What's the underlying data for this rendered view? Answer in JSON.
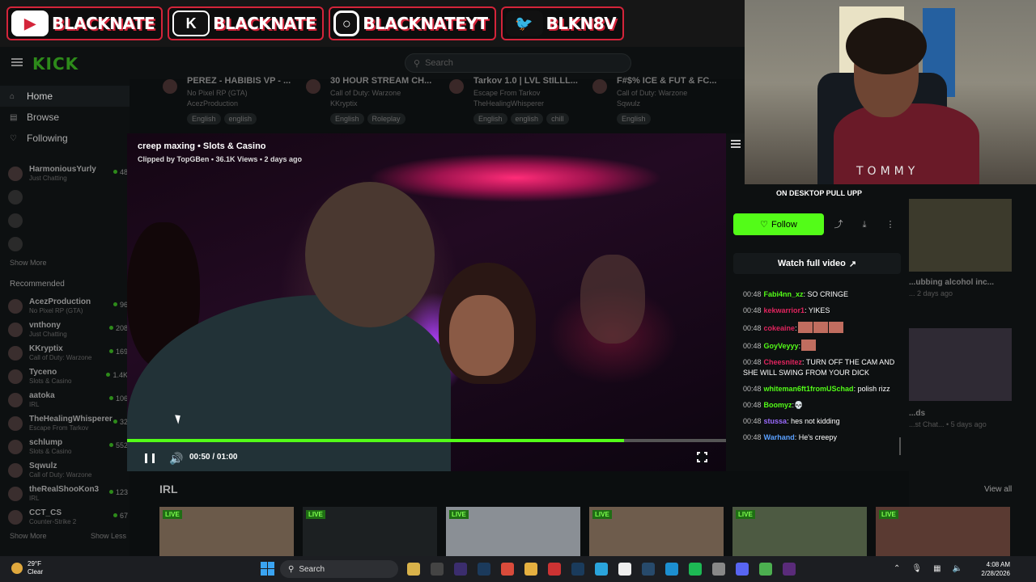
{
  "social": [
    {
      "icon": "youtube-icon",
      "label": "BLACKNATE"
    },
    {
      "icon": "kick-icon",
      "label": "BLACKNATE"
    },
    {
      "icon": "instagram-icon",
      "label": "BLACKNATEYT"
    },
    {
      "icon": "twitter-icon",
      "label": "BLKN8V"
    }
  ],
  "topbar": {
    "logo": "KICK",
    "search_placeholder": "Search"
  },
  "sidebar": {
    "nav": [
      "Home",
      "Browse",
      "Following"
    ],
    "following": [
      {
        "name": "HarmoniousYurly",
        "game": "Just Chatting",
        "viewers": "48"
      },
      {
        "name": "",
        "game": "",
        "viewers": ""
      },
      {
        "name": "",
        "game": "",
        "viewers": ""
      },
      {
        "name": "",
        "game": "",
        "viewers": ""
      }
    ],
    "show_more": "Show More",
    "recommended_title": "Recommended",
    "recommended": [
      {
        "name": "AcezProduction",
        "game": "No Pixel RP (GTA)",
        "viewers": "96"
      },
      {
        "name": "vnthony",
        "game": "Just Chatting",
        "viewers": "208"
      },
      {
        "name": "KKryptix",
        "game": "Call of Duty: Warzone",
        "viewers": "169"
      },
      {
        "name": "Tyceno",
        "game": "Slots & Casino",
        "viewers": "1.4K"
      },
      {
        "name": "aatoka",
        "game": "IRL",
        "viewers": "106"
      },
      {
        "name": "TheHealingWhisperer",
        "game": "Escape From Tarkov",
        "viewers": "32"
      },
      {
        "name": "schlump",
        "game": "Slots & Casino",
        "viewers": "552"
      },
      {
        "name": "Sqwulz",
        "game": "Call of Duty: Warzone",
        "viewers": ""
      },
      {
        "name": "theRealShooKon3",
        "game": "IRL",
        "viewers": "123"
      },
      {
        "name": "CCT_CS",
        "game": "Counter-Strike 2",
        "viewers": "67"
      }
    ],
    "show_more2": "Show More",
    "show_less": "Show Less"
  },
  "strip": [
    {
      "title": "PEREZ - HABIBIS VP - ...",
      "game": "No Pixel RP (GTA)",
      "channel": "AcezProduction",
      "tags": [
        "English",
        "english"
      ]
    },
    {
      "title": "30 HOUR STREAM CH...",
      "game": "Call of Duty: Warzone",
      "channel": "KKryptix",
      "tags": [
        "English",
        "Roleplay"
      ]
    },
    {
      "title": "Tarkov 1.0 | LVL StILLL...",
      "game": "Escape From Tarkov",
      "channel": "TheHealingWhisperer",
      "tags": [
        "English",
        "english",
        "chill"
      ]
    },
    {
      "title": "F#$% ICE & FUT & FC...",
      "game": "Call of Duty: Warzone",
      "channel": "Sqwulz",
      "tags": [
        "English"
      ]
    }
  ],
  "video": {
    "title": "creep maxing • Slots & Casino",
    "subtitle": "Clipped by TopGBen • 36.1K Views • 2 days ago",
    "time": "00:50 / 01:00",
    "progress": 0.83
  },
  "panel": {
    "streamer_line": "ON DESKTOP PULL UPP",
    "follow": "Follow",
    "watch_full": "Watch full video"
  },
  "chat": [
    {
      "time": "00:48",
      "user": "Fabi4nn_xz",
      "color": "#53fc18",
      "text": ": SO CRINGE"
    },
    {
      "time": "00:48",
      "user": "kekwarrior1",
      "color": "#e0245e",
      "text": ": YIKES"
    },
    {
      "time": "00:48",
      "user": "cokeaine",
      "color": "#e0245e",
      "text": ":"
    },
    {
      "time": "00:48",
      "user": "GoyVeyyy",
      "color": "#53fc18",
      "text": ":"
    },
    {
      "time": "00:48",
      "user": "Cheesnitez",
      "color": "#e0245e",
      "text": ": TURN OFF THE CAM AND SHE WILL SWING FROM YOUR DICK"
    },
    {
      "time": "00:48",
      "user": "whiteman6ft1fromUSchad",
      "color": "#53fc18",
      "text": ": polish rizz"
    },
    {
      "time": "00:48",
      "user": "Boomyz",
      "color": "#53fc18",
      "text": ":"
    },
    {
      "time": "00:48",
      "user": "stussa",
      "color": "#9b6bff",
      "text": ": hes not kidding"
    },
    {
      "time": "00:48",
      "user": "Warhand",
      "color": "#5aa0ff",
      "text": ": He's creepy"
    }
  ],
  "right_cards": {
    "title": "...ubbing alcohol inc...",
    "meta": "... 2 days ago",
    "title2": "...ds",
    "meta2": "...st Chat... • 5 days ago"
  },
  "irl": {
    "title": "IRL",
    "view_all": "View all",
    "live": "LIVE"
  },
  "webcam": {
    "shirt_text": "TOMMY"
  },
  "taskbar": {
    "temp": "29°F",
    "weather": "Clear",
    "search": "Search",
    "time": "4:08 AM",
    "date": "2/28/2026"
  }
}
